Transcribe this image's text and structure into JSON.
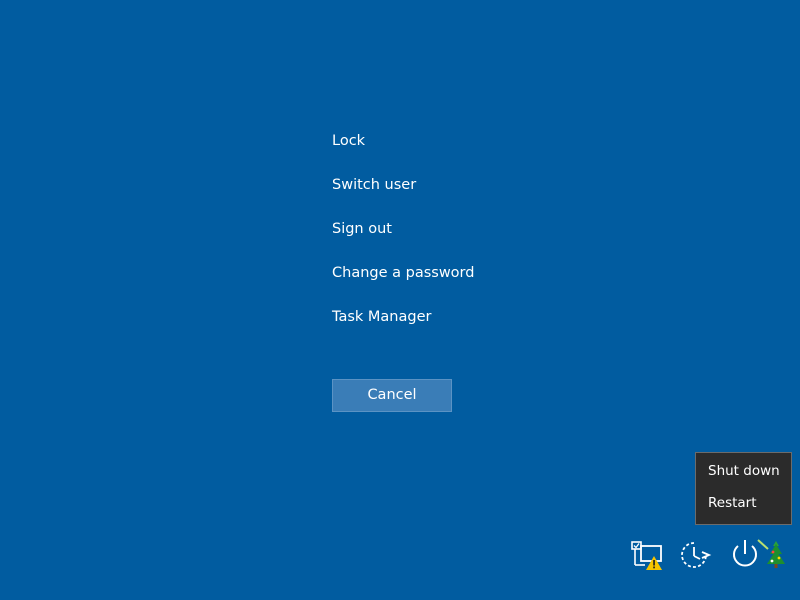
{
  "menu": {
    "items": [
      {
        "label": "Lock"
      },
      {
        "label": "Switch user"
      },
      {
        "label": "Sign out"
      },
      {
        "label": "Change a password"
      },
      {
        "label": "Task Manager"
      }
    ]
  },
  "cancel": {
    "label": "Cancel"
  },
  "power_menu": {
    "items": [
      {
        "label": "Shut down"
      },
      {
        "label": "Restart"
      }
    ]
  },
  "tray": {
    "icons": [
      "network-warning-icon",
      "accessibility-icon",
      "power-icon",
      "tree-icon"
    ]
  },
  "colors": {
    "background": "#015ca0",
    "button": "#3a7db7",
    "popup": "#2b2b2b",
    "warning": "#f5c400",
    "tree": "#1e8f2e"
  }
}
